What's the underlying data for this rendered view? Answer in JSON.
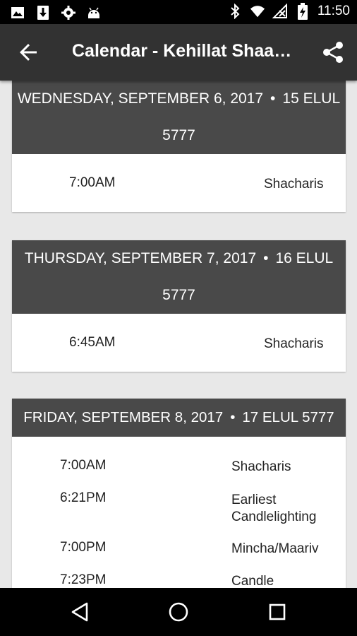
{
  "status_bar": {
    "time": "11:50",
    "left_icons": [
      "image-icon",
      "download-icon",
      "settings-icon",
      "android-icon"
    ],
    "right_icons": [
      "bluetooth-icon",
      "wifi-icon",
      "no-signal-icon",
      "battery-icon"
    ]
  },
  "app_bar": {
    "title": "Calendar - Kehillat Shaa…",
    "back_icon": "arrow-back-icon",
    "share_icon": "share-icon"
  },
  "days": [
    {
      "date": "WEDNESDAY, SEPTEMBER 6, 2017",
      "separator": "•",
      "hebrew_date": "15 ELUL 5777",
      "events": [
        {
          "time": "7:00AM",
          "name": "Shacharis"
        }
      ]
    },
    {
      "date": "THURSDAY, SEPTEMBER 7, 2017",
      "separator": "•",
      "hebrew_date": "16 ELUL 5777",
      "events": [
        {
          "time": "6:45AM",
          "name": "Shacharis"
        }
      ]
    },
    {
      "date": "FRIDAY, SEPTEMBER 8, 2017",
      "separator": "•",
      "hebrew_date": "17 ELUL 5777",
      "events": [
        {
          "time": "7:00AM",
          "name": "Shacharis"
        },
        {
          "time": "6:21PM",
          "name": "Earliest Candlelighting"
        },
        {
          "time": "7:00PM",
          "name": "Mincha/Maariv"
        },
        {
          "time": "7:23PM",
          "name": "Candle"
        }
      ]
    }
  ],
  "nav_bar": {
    "back_icon": "nav-back-icon",
    "home_icon": "nav-home-icon",
    "recents_icon": "nav-recents-icon"
  }
}
